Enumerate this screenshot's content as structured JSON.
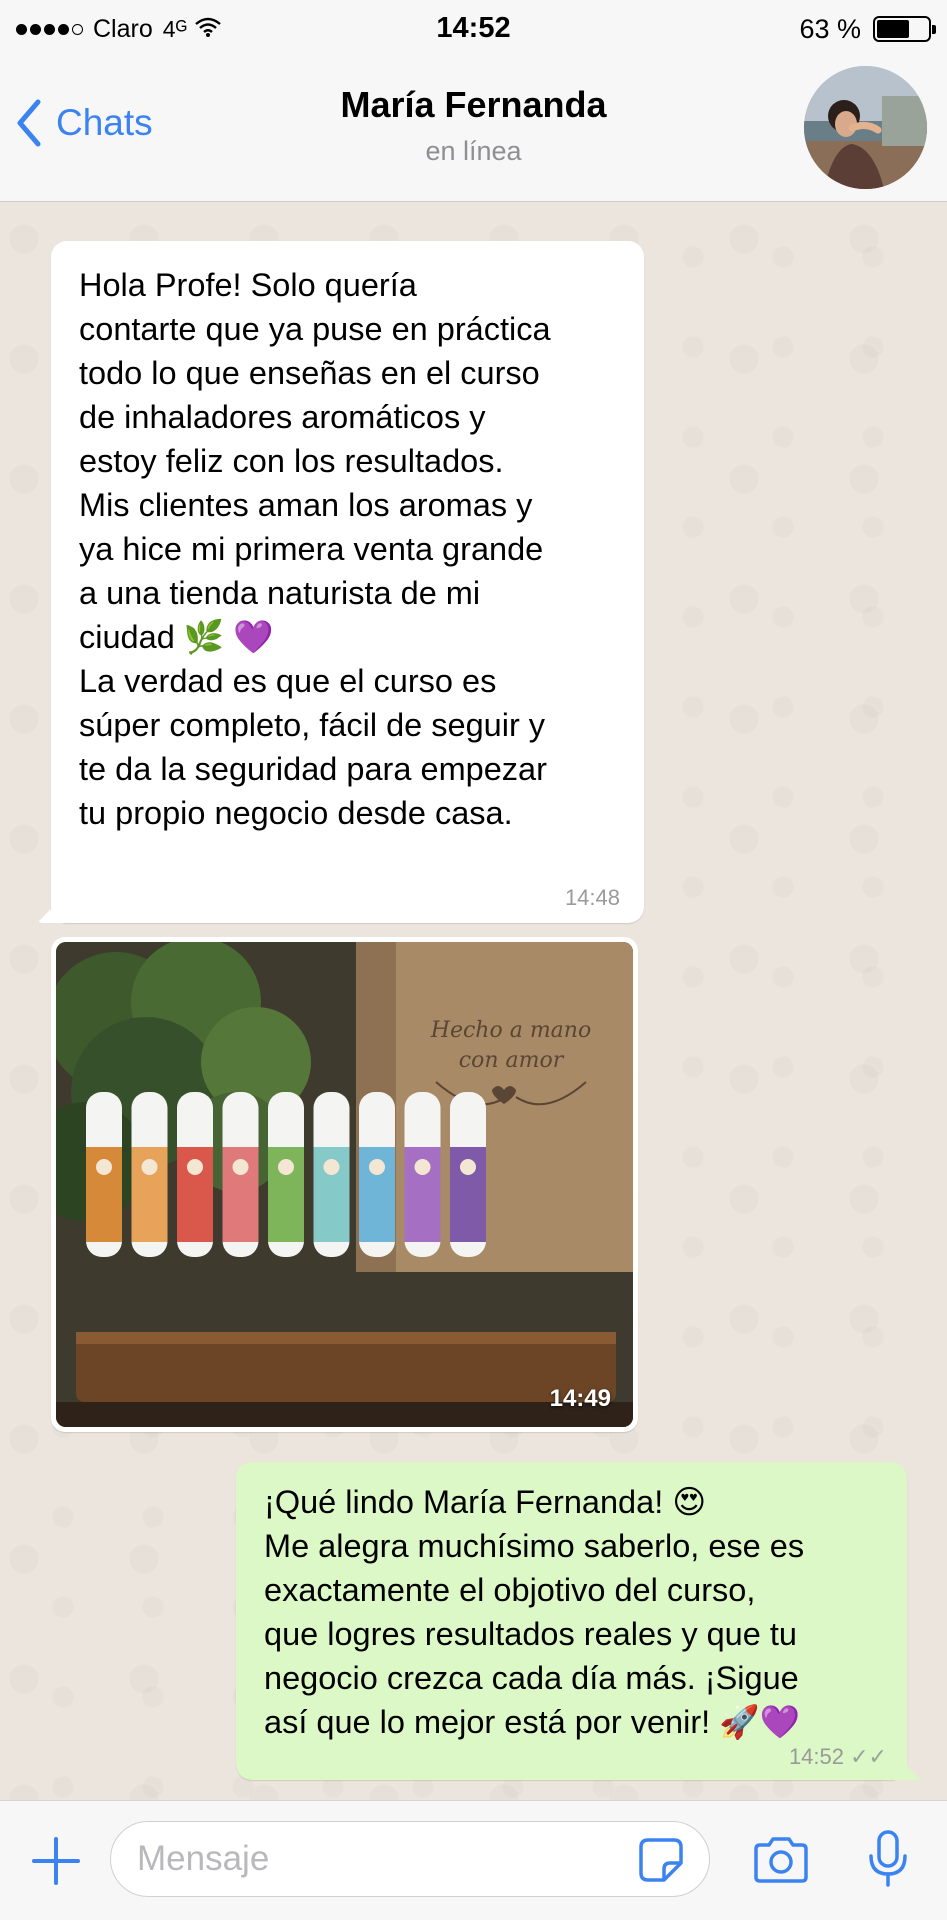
{
  "status_bar": {
    "carrier": "Claro",
    "network": "4ᴳ",
    "time": "14:52",
    "battery_label": "63 %",
    "battery_level": 0.63
  },
  "header": {
    "back_label": "Chats",
    "contact_name": "María Fernanda",
    "contact_status": "en línea"
  },
  "messages": [
    {
      "direction": "incoming",
      "text": "Hola Profe! Solo quería\ncontarte que ya puse en práctica\ntodo lo que enseñas en el curso\nde inhaladores aromáticos y\nestoy feliz con los resultados.\nMis clientes aman los aromas y\nya hice mi primera venta grande\na una tienda naturista de mi\nciudad",
      "emoji_leaf": "🌿",
      "emoji_heart": "💜",
      "text_after": "La verdad es que el curso es\nsúper completo, fácil de seguir y\nte da la seguridad para empezar\ntu propio negocio desde casa.",
      "time": "14:48"
    },
    {
      "direction": "incoming",
      "type": "image",
      "photo_text_line1": "Hecho a mano",
      "photo_text_line2": "con amor",
      "time": "14:49"
    },
    {
      "direction": "outgoing",
      "text_line1": "¡Qué lindo María Fernanda!",
      "emoji_smile": "😍",
      "text": "Me alegra muchísimo saberlo, ese es\nexactamente el objotivo del curso,\nque logres resultados reales y que tu\nnegocio crezca cada día más. ¡Sigue\nasí que lo mejor está por venir!",
      "emoji_rocket": "🚀",
      "emoji_heart": "💜",
      "time": "14:52",
      "read_receipt": "✓✓"
    }
  ],
  "input_bar": {
    "placeholder": "Mensaje"
  },
  "colors": {
    "accent": "#3b83f0",
    "outgoing_bubble": "#dcf8c6",
    "incoming_bubble": "#ffffff",
    "chat_background": "#ece5dd"
  }
}
